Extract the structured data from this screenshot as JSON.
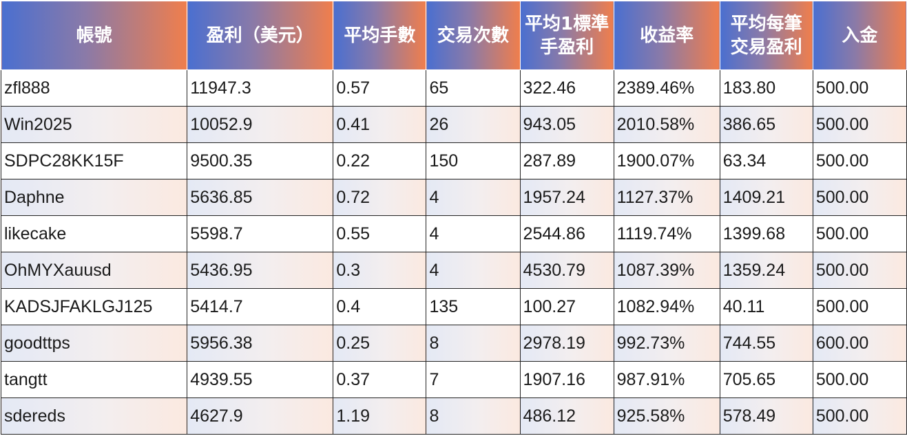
{
  "table": {
    "headers": [
      "帳號",
      "盈利（美元）",
      "平均手數",
      "交易次數",
      "平均1標準手盈利",
      "收益率",
      "平均每筆交易盈利",
      "入金"
    ],
    "rows": [
      [
        "zfl888",
        "11947.3",
        "0.57",
        "65",
        "322.46",
        "2389.46%",
        "183.80",
        "500.00"
      ],
      [
        "Win2025",
        "10052.9",
        "0.41",
        "26",
        "943.05",
        "2010.58%",
        "386.65",
        "500.00"
      ],
      [
        "SDPC28KK15F",
        "9500.35",
        "0.22",
        "150",
        "287.89",
        "1900.07%",
        "63.34",
        "500.00"
      ],
      [
        "Daphne",
        "5636.85",
        "0.72",
        "4",
        "1957.24",
        "1127.37%",
        "1409.21",
        "500.00"
      ],
      [
        "likecake",
        "5598.7",
        "0.55",
        "4",
        "2544.86",
        "1119.74%",
        "1399.68",
        "500.00"
      ],
      [
        "OhMYXauusd",
        "5436.95",
        "0.3",
        "4",
        "4530.79",
        "1087.39%",
        "1359.24",
        "500.00"
      ],
      [
        "KADSJFAKLGJ125",
        "5414.7",
        "0.4",
        "135",
        "100.27",
        "1082.94%",
        "40.11",
        "500.00"
      ],
      [
        "goodttps",
        "5956.38",
        "0.25",
        "8",
        "2978.19",
        "992.73%",
        "744.55",
        "600.00"
      ],
      [
        "tangtt",
        "4939.55",
        "0.37",
        "7",
        "1907.16",
        "987.91%",
        "705.65",
        "500.00"
      ],
      [
        "sdereds",
        "4627.9",
        "1.19",
        "8",
        "486.12",
        "925.58%",
        "578.49",
        "500.00"
      ]
    ]
  }
}
